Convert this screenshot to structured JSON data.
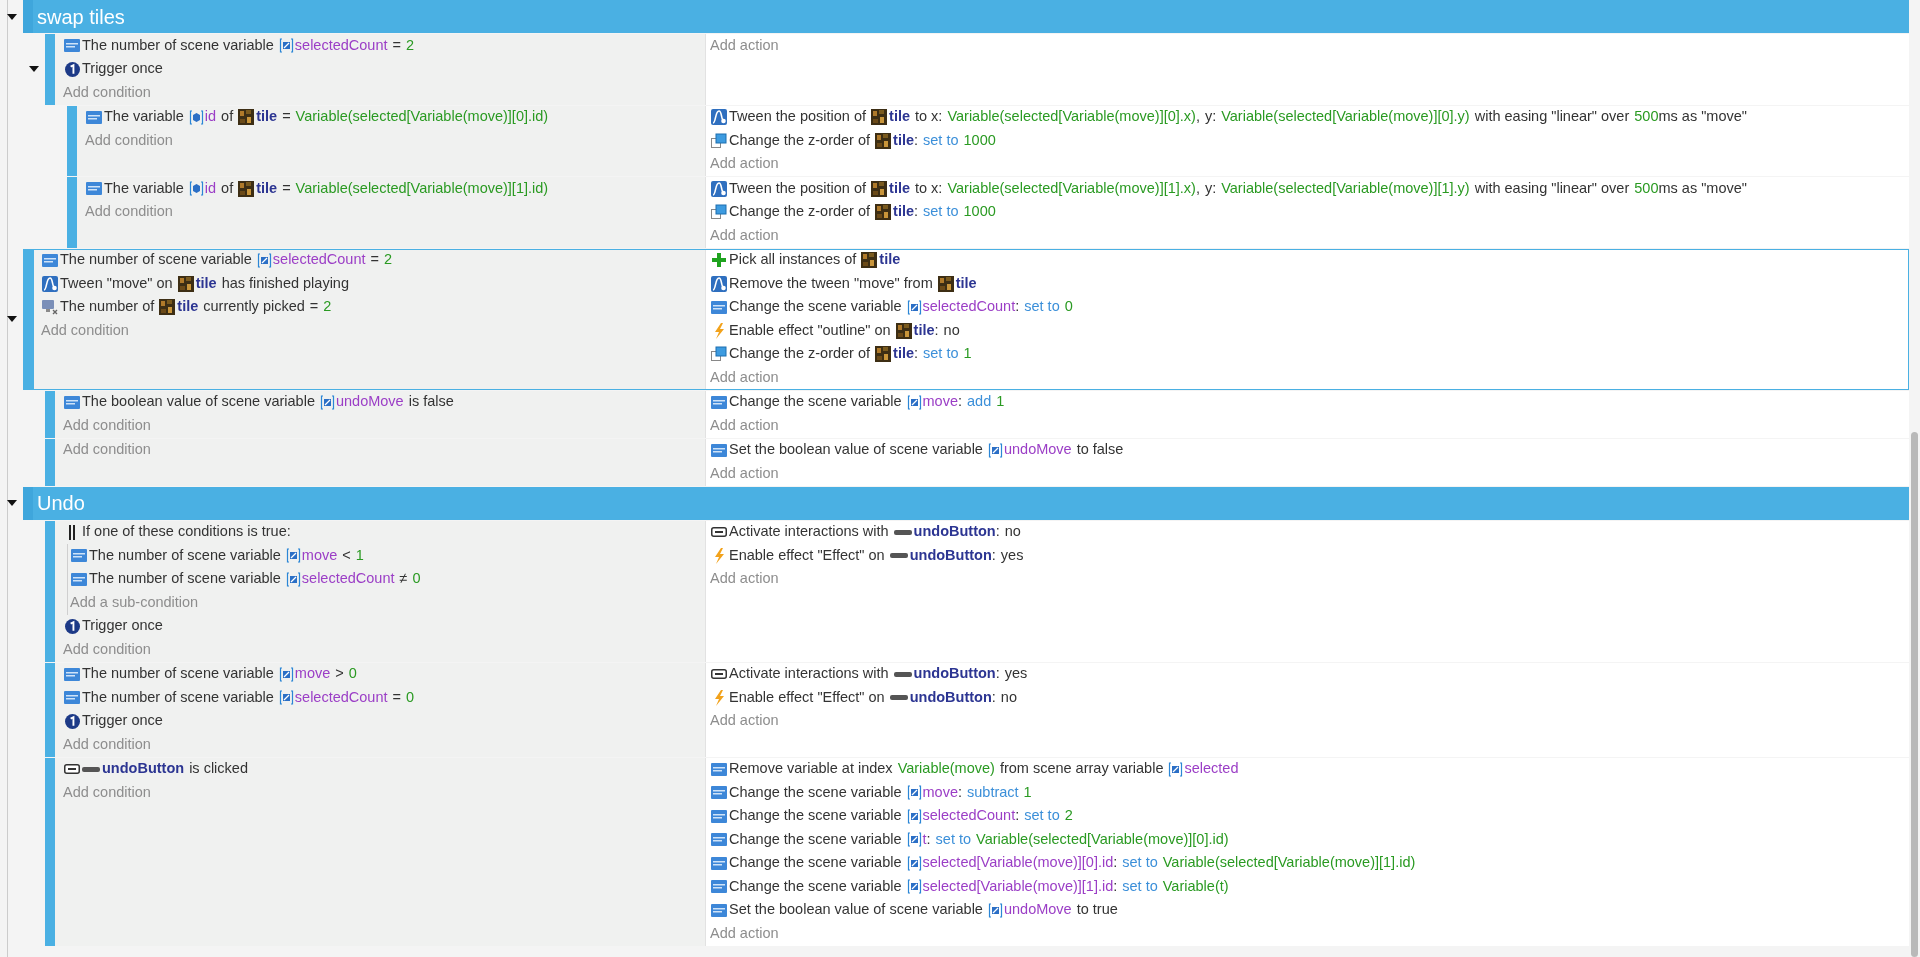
{
  "events": [
    {
      "kind": "group",
      "title": "swap tiles",
      "expanded": true,
      "children": [
        {
          "kind": "event",
          "selected": false,
          "expanded": true,
          "add_condition": "Add condition",
          "add_action": "Add action",
          "conditions": [
            {
              "kind": "var",
              "parts": [
                {
                  "kind": "text",
                  "text": "The number of scene variable"
                },
                {
                  "kind": "svar",
                  "text": "selectedCount"
                },
                {
                  "kind": "text",
                  "text": "="
                },
                {
                  "kind": "num",
                  "text": "2"
                }
              ]
            },
            {
              "kind": "trigger",
              "parts": [
                {
                  "kind": "text",
                  "text": "Trigger once"
                }
              ]
            }
          ],
          "children": [
            {
              "kind": "event",
              "selected": false,
              "add_condition": "Add condition",
              "add_action": "Add action",
              "conditions": [
                {
                  "kind": "var",
                  "parts": [
                    {
                      "kind": "text",
                      "text": "The variable"
                    },
                    {
                      "kind": "ovar",
                      "text": "id"
                    },
                    {
                      "kind": "text",
                      "text": "of"
                    },
                    {
                      "kind": "obj",
                      "text": "tile"
                    },
                    {
                      "kind": "text",
                      "text": "="
                    },
                    {
                      "kind": "num",
                      "text": "Variable(selected[Variable(move)][0].id)"
                    }
                  ]
                }
              ],
              "actions": [
                {
                  "kind": "tween",
                  "parts": [
                    {
                      "kind": "text",
                      "text": "Tween the position of"
                    },
                    {
                      "kind": "obj",
                      "text": "tile"
                    },
                    {
                      "kind": "text",
                      "text": "to x:"
                    },
                    {
                      "kind": "num",
                      "text": "Variable(selected[Variable(move)][0].x)"
                    },
                    {
                      "kind": "punct",
                      "text": ","
                    },
                    {
                      "kind": "text",
                      "text": "y:"
                    },
                    {
                      "kind": "num",
                      "text": "Variable(selected[Variable(move)][0].y)"
                    },
                    {
                      "kind": "text",
                      "text": "with easing \"linear\" over"
                    },
                    {
                      "kind": "num",
                      "text": "500"
                    },
                    {
                      "kind": "punct",
                      "text": "ms as \"move\""
                    }
                  ]
                },
                {
                  "kind": "zorder",
                  "parts": [
                    {
                      "kind": "text",
                      "text": "Change the z-order of"
                    },
                    {
                      "kind": "obj",
                      "text": "tile"
                    },
                    {
                      "kind": "punct",
                      "text": ":"
                    },
                    {
                      "kind": "op",
                      "text": "set to"
                    },
                    {
                      "kind": "num",
                      "text": "1000"
                    }
                  ]
                }
              ]
            },
            {
              "kind": "event",
              "selected": false,
              "add_condition": "Add condition",
              "add_action": "Add action",
              "conditions": [
                {
                  "kind": "var",
                  "parts": [
                    {
                      "kind": "text",
                      "text": "The variable"
                    },
                    {
                      "kind": "ovar",
                      "text": "id"
                    },
                    {
                      "kind": "text",
                      "text": "of"
                    },
                    {
                      "kind": "obj",
                      "text": "tile"
                    },
                    {
                      "kind": "text",
                      "text": "="
                    },
                    {
                      "kind": "num",
                      "text": "Variable(selected[Variable(move)][1].id)"
                    }
                  ]
                }
              ],
              "actions": [
                {
                  "kind": "tween",
                  "parts": [
                    {
                      "kind": "text",
                      "text": "Tween the position of"
                    },
                    {
                      "kind": "obj",
                      "text": "tile"
                    },
                    {
                      "kind": "text",
                      "text": "to x:"
                    },
                    {
                      "kind": "num",
                      "text": "Variable(selected[Variable(move)][1].x)"
                    },
                    {
                      "kind": "punct",
                      "text": ","
                    },
                    {
                      "kind": "text",
                      "text": "y:"
                    },
                    {
                      "kind": "num",
                      "text": "Variable(selected[Variable(move)][1].y)"
                    },
                    {
                      "kind": "text",
                      "text": "with easing \"linear\" over"
                    },
                    {
                      "kind": "num",
                      "text": "500"
                    },
                    {
                      "kind": "punct",
                      "text": "ms as \"move\""
                    }
                  ]
                },
                {
                  "kind": "zorder",
                  "parts": [
                    {
                      "kind": "text",
                      "text": "Change the z-order of"
                    },
                    {
                      "kind": "obj",
                      "text": "tile"
                    },
                    {
                      "kind": "punct",
                      "text": ":"
                    },
                    {
                      "kind": "op",
                      "text": "set to"
                    },
                    {
                      "kind": "num",
                      "text": "1000"
                    }
                  ]
                }
              ]
            }
          ]
        }
      ]
    },
    {
      "kind": "event",
      "selected": true,
      "expanded": true,
      "add_condition": "Add condition",
      "add_action": "Add action",
      "conditions": [
        {
          "kind": "var",
          "parts": [
            {
              "kind": "text",
              "text": "The number of scene variable"
            },
            {
              "kind": "svar",
              "text": "selectedCount"
            },
            {
              "kind": "text",
              "text": "="
            },
            {
              "kind": "num",
              "text": "2"
            }
          ]
        },
        {
          "kind": "tween",
          "parts": [
            {
              "kind": "text",
              "text": "Tween \"move\" on"
            },
            {
              "kind": "obj",
              "text": "tile"
            },
            {
              "kind": "text",
              "text": "has finished playing"
            }
          ]
        },
        {
          "kind": "pickcount",
          "parts": [
            {
              "kind": "text",
              "text": "The number of"
            },
            {
              "kind": "obj",
              "text": "tile"
            },
            {
              "kind": "text",
              "text": "currently picked"
            },
            {
              "kind": "text",
              "text": "="
            },
            {
              "kind": "num",
              "text": "2"
            }
          ]
        }
      ],
      "actions": [
        {
          "kind": "pickall",
          "parts": [
            {
              "kind": "text",
              "text": "Pick all instances of"
            },
            {
              "kind": "obj",
              "text": "tile"
            }
          ]
        },
        {
          "kind": "tween",
          "parts": [
            {
              "kind": "text",
              "text": "Remove the tween \"move\" from"
            },
            {
              "kind": "obj",
              "text": "tile"
            }
          ]
        },
        {
          "kind": "var",
          "parts": [
            {
              "kind": "text",
              "text": "Change the scene variable"
            },
            {
              "kind": "svar",
              "text": "selectedCount"
            },
            {
              "kind": "punct",
              "text": ":"
            },
            {
              "kind": "op",
              "text": "set to"
            },
            {
              "kind": "num",
              "text": "0"
            }
          ]
        },
        {
          "kind": "effect",
          "parts": [
            {
              "kind": "text",
              "text": "Enable effect \"outline\" on"
            },
            {
              "kind": "obj",
              "text": "tile"
            },
            {
              "kind": "punct",
              "text": ":"
            },
            {
              "kind": "text",
              "text": "no"
            }
          ]
        },
        {
          "kind": "zorder",
          "parts": [
            {
              "kind": "text",
              "text": "Change the z-order of"
            },
            {
              "kind": "obj",
              "text": "tile"
            },
            {
              "kind": "punct",
              "text": ":"
            },
            {
              "kind": "op",
              "text": "set to"
            },
            {
              "kind": "num",
              "text": "1"
            }
          ]
        }
      ],
      "children": [
        {
          "kind": "event",
          "selected": false,
          "add_condition": "Add condition",
          "add_action": "Add action",
          "conditions": [
            {
              "kind": "var",
              "parts": [
                {
                  "kind": "text",
                  "text": "The boolean value of scene variable"
                },
                {
                  "kind": "svar",
                  "text": "undoMove"
                },
                {
                  "kind": "text",
                  "text": "is false"
                }
              ]
            }
          ],
          "actions": [
            {
              "kind": "var",
              "parts": [
                {
                  "kind": "text",
                  "text": "Change the scene variable"
                },
                {
                  "kind": "svar",
                  "text": "move"
                },
                {
                  "kind": "punct",
                  "text": ":"
                },
                {
                  "kind": "op",
                  "text": "add"
                },
                {
                  "kind": "num",
                  "text": "1"
                }
              ]
            }
          ]
        },
        {
          "kind": "event",
          "selected": false,
          "add_condition": "Add condition",
          "add_action": "Add action",
          "actions": [
            {
              "kind": "var",
              "parts": [
                {
                  "kind": "text",
                  "text": "Set the boolean value of scene variable"
                },
                {
                  "kind": "svar",
                  "text": "undoMove"
                },
                {
                  "kind": "text",
                  "text": "to false"
                }
              ]
            }
          ]
        }
      ]
    },
    {
      "kind": "group",
      "title": "Undo",
      "expanded": true,
      "children": [
        {
          "kind": "event",
          "selected": false,
          "add_condition": "Add condition",
          "add_action": "Add action",
          "conditions": [
            {
              "kind": "or",
              "parts": [
                {
                  "kind": "text",
                  "text": "If one of these conditions is true:"
                }
              ],
              "add_sub": "Add a sub-condition",
              "sub": [
                {
                  "kind": "var",
                  "parts": [
                    {
                      "kind": "text",
                      "text": "The number of scene variable"
                    },
                    {
                      "kind": "svar",
                      "text": "move"
                    },
                    {
                      "kind": "text",
                      "text": "<"
                    },
                    {
                      "kind": "num",
                      "text": "1"
                    }
                  ]
                },
                {
                  "kind": "var",
                  "parts": [
                    {
                      "kind": "text",
                      "text": "The number of scene variable"
                    },
                    {
                      "kind": "svar",
                      "text": "selectedCount"
                    },
                    {
                      "kind": "text",
                      "text": "≠"
                    },
                    {
                      "kind": "num",
                      "text": "0"
                    }
                  ]
                }
              ]
            },
            {
              "kind": "trigger",
              "parts": [
                {
                  "kind": "text",
                  "text": "Trigger once"
                }
              ]
            }
          ],
          "actions": [
            {
              "kind": "interaction",
              "parts": [
                {
                  "kind": "text",
                  "text": "Activate interactions with"
                },
                {
                  "kind": "btn",
                  "text": "undoButton"
                },
                {
                  "kind": "punct",
                  "text": ":"
                },
                {
                  "kind": "text",
                  "text": "no"
                }
              ]
            },
            {
              "kind": "effect",
              "parts": [
                {
                  "kind": "text",
                  "text": "Enable effect \"Effect\" on"
                },
                {
                  "kind": "btn",
                  "text": "undoButton"
                },
                {
                  "kind": "punct",
                  "text": ":"
                },
                {
                  "kind": "text",
                  "text": "yes"
                }
              ]
            }
          ]
        },
        {
          "kind": "event",
          "selected": false,
          "add_condition": "Add condition",
          "add_action": "Add action",
          "conditions": [
            {
              "kind": "var",
              "parts": [
                {
                  "kind": "text",
                  "text": "The number of scene variable"
                },
                {
                  "kind": "svar",
                  "text": "move"
                },
                {
                  "kind": "text",
                  "text": ">"
                },
                {
                  "kind": "num",
                  "text": "0"
                }
              ]
            },
            {
              "kind": "var",
              "parts": [
                {
                  "kind": "text",
                  "text": "The number of scene variable"
                },
                {
                  "kind": "svar",
                  "text": "selectedCount"
                },
                {
                  "kind": "text",
                  "text": "="
                },
                {
                  "kind": "num",
                  "text": "0"
                }
              ]
            },
            {
              "kind": "trigger",
              "parts": [
                {
                  "kind": "text",
                  "text": "Trigger once"
                }
              ]
            }
          ],
          "actions": [
            {
              "kind": "interaction",
              "parts": [
                {
                  "kind": "text",
                  "text": "Activate interactions with"
                },
                {
                  "kind": "btn",
                  "text": "undoButton"
                },
                {
                  "kind": "punct",
                  "text": ":"
                },
                {
                  "kind": "text",
                  "text": "yes"
                }
              ]
            },
            {
              "kind": "effect",
              "parts": [
                {
                  "kind": "text",
                  "text": "Enable effect \"Effect\" on"
                },
                {
                  "kind": "btn",
                  "text": "undoButton"
                },
                {
                  "kind": "punct",
                  "text": ":"
                },
                {
                  "kind": "text",
                  "text": "no"
                }
              ]
            }
          ]
        },
        {
          "kind": "event",
          "selected": false,
          "add_condition": "Add condition",
          "add_action": "Add action",
          "conditions": [
            {
              "kind": "interaction",
              "parts": [
                {
                  "kind": "btn",
                  "text": "undoButton"
                },
                {
                  "kind": "text",
                  "text": "is clicked"
                }
              ]
            }
          ],
          "actions": [
            {
              "kind": "var",
              "parts": [
                {
                  "kind": "text",
                  "text": "Remove variable at index"
                },
                {
                  "kind": "num",
                  "text": "Variable(move)"
                },
                {
                  "kind": "text",
                  "text": "from scene array variable"
                },
                {
                  "kind": "svar",
                  "text": "selected"
                }
              ]
            },
            {
              "kind": "var",
              "parts": [
                {
                  "kind": "text",
                  "text": "Change the scene variable"
                },
                {
                  "kind": "svar",
                  "text": "move"
                },
                {
                  "kind": "punct",
                  "text": ":"
                },
                {
                  "kind": "op",
                  "text": "subtract"
                },
                {
                  "kind": "num",
                  "text": "1"
                }
              ]
            },
            {
              "kind": "var",
              "parts": [
                {
                  "kind": "text",
                  "text": "Change the scene variable"
                },
                {
                  "kind": "svar",
                  "text": "selectedCount"
                },
                {
                  "kind": "punct",
                  "text": ":"
                },
                {
                  "kind": "op",
                  "text": "set to"
                },
                {
                  "kind": "num",
                  "text": "2"
                }
              ]
            },
            {
              "kind": "var",
              "parts": [
                {
                  "kind": "text",
                  "text": "Change the scene variable"
                },
                {
                  "kind": "svar",
                  "text": "t"
                },
                {
                  "kind": "punct",
                  "text": ":"
                },
                {
                  "kind": "op",
                  "text": "set to"
                },
                {
                  "kind": "num",
                  "text": "Variable(selected[Variable(move)][0].id)"
                }
              ]
            },
            {
              "kind": "var",
              "parts": [
                {
                  "kind": "text",
                  "text": "Change the scene variable"
                },
                {
                  "kind": "svar",
                  "text": "selected[Variable(move)][0].id"
                },
                {
                  "kind": "punct",
                  "text": ":"
                },
                {
                  "kind": "op",
                  "text": "set to"
                },
                {
                  "kind": "num",
                  "text": "Variable(selected[Variable(move)][1].id)"
                }
              ]
            },
            {
              "kind": "var",
              "parts": [
                {
                  "kind": "text",
                  "text": "Change the scene variable"
                },
                {
                  "kind": "svar",
                  "text": "selected[Variable(move)][1].id"
                },
                {
                  "kind": "punct",
                  "text": ":"
                },
                {
                  "kind": "op",
                  "text": "set to"
                },
                {
                  "kind": "num",
                  "text": "Variable(t)"
                }
              ]
            },
            {
              "kind": "var",
              "parts": [
                {
                  "kind": "text",
                  "text": "Set the boolean value of scene variable"
                },
                {
                  "kind": "svar",
                  "text": "undoMove"
                },
                {
                  "kind": "text",
                  "text": "to true"
                }
              ]
            }
          ]
        }
      ]
    }
  ]
}
